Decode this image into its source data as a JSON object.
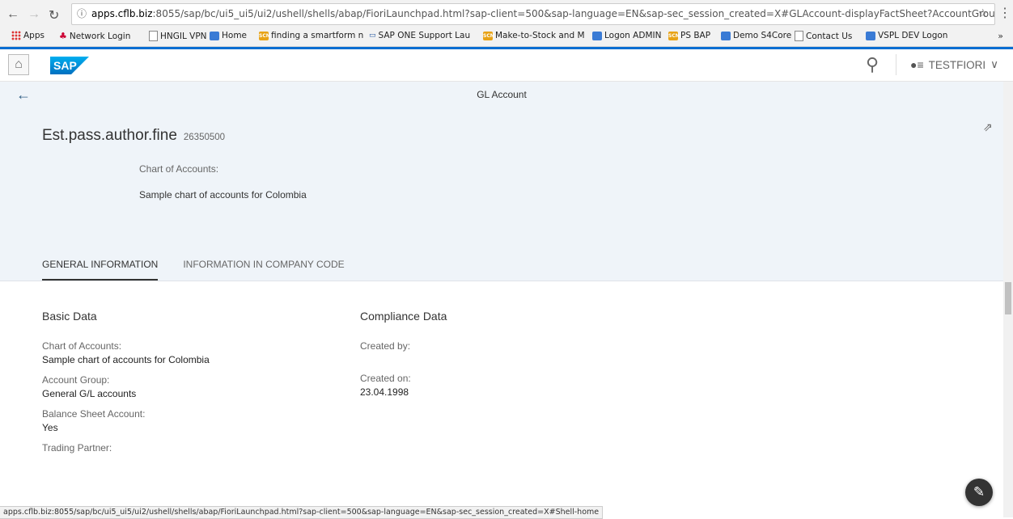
{
  "browser": {
    "url_host": "apps.cflb.biz",
    "url_rest": ":8055/sap/bc/ui5_ui5/ui2/ushell/shells/abap/FioriLaunchpad.html?sap-client=500&sap-language=EN&sap-sec_session_created=X#GLAccount-displayFactSheet?AccountGroupNan",
    "bookmarks": [
      {
        "label": "Apps",
        "icon": "apps"
      },
      {
        "label": "Network Login",
        "icon": "network"
      },
      {
        "label": "HNGIL VPN",
        "icon": "doc"
      },
      {
        "label": "Home",
        "icon": "sap"
      },
      {
        "label": "finding a smartform n",
        "icon": "scn"
      },
      {
        "label": "SAP ONE Support Lau",
        "icon": "sapone"
      },
      {
        "label": "Make-to-Stock and M",
        "icon": "scn"
      },
      {
        "label": "Logon ADMIN",
        "icon": "sap"
      },
      {
        "label": "PS BAP",
        "icon": "scn"
      },
      {
        "label": "Demo S4Core",
        "icon": "sap"
      },
      {
        "label": "Contact Us",
        "icon": "doc"
      },
      {
        "label": "VSPL DEV Logon",
        "icon": "sap"
      }
    ],
    "more": "»",
    "status_url": "apps.cflb.biz:8055/sap/bc/ui5_ui5/ui2/ushell/shells/abap/FioriLaunchpad.html?sap-client=500&sap-language=EN&sap-sec_session_created=X#Shell-home"
  },
  "shell": {
    "logo": "SAP",
    "user": "TESTFIORI"
  },
  "header": {
    "page_title": "GL Account",
    "object_title": "Est.pass.author.fine",
    "object_number": "26350500",
    "attribute_label": "Chart of Accounts:",
    "attribute_value": "Sample chart of accounts for Colombia"
  },
  "tabs": [
    {
      "label": "GENERAL INFORMATION",
      "active": true
    },
    {
      "label": "INFORMATION IN COMPANY CODE",
      "active": false
    }
  ],
  "basic_data": {
    "title": "Basic Data",
    "fields": [
      {
        "label": "Chart of Accounts:",
        "value": "Sample chart of accounts for Colombia"
      },
      {
        "label": "Account Group:",
        "value": "General G/L accounts"
      },
      {
        "label": "Balance Sheet Account:",
        "value": "Yes"
      },
      {
        "label": "Trading Partner:",
        "value": ""
      }
    ]
  },
  "compliance_data": {
    "title": "Compliance Data",
    "fields": [
      {
        "label": "Created by:",
        "value": ""
      },
      {
        "label": "Created on:",
        "value": "23.04.1998"
      }
    ]
  },
  "colors": {
    "accent": "#0a6ed1",
    "header_bg": "#eff4f9"
  }
}
